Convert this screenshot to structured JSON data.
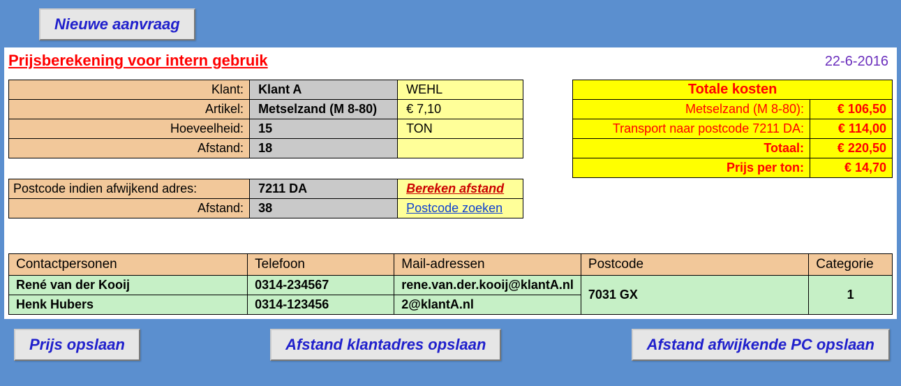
{
  "header": {
    "new_request": "Nieuwe aanvraag"
  },
  "title": "Prijsberekening voor intern gebruik",
  "date": "22-6-2016",
  "inputs": {
    "klant_label": "Klant:",
    "klant": "Klant A",
    "klant_plaats": "WEHL",
    "artikel_label": "Artikel:",
    "artikel": "Metselzand (M 8-80)",
    "artikel_prijs": "€ 7,10",
    "hoeveelheid_label": "Hoeveelheid:",
    "hoeveelheid": "15",
    "hoeveelheid_unit": "TON",
    "afstand_label": "Afstand:",
    "afstand": "18",
    "postcode_afw_label": "Postcode indien afwijkend adres:",
    "postcode_afw": "7211 DA",
    "bereken_afstand": "Bereken afstand",
    "afstand2_label": "Afstand:",
    "afstand2": "38",
    "postcode_zoeken": "Postcode zoeken"
  },
  "costs": {
    "head": "Totale kosten",
    "l1_label": "Metselzand (M 8-80):",
    "l1_val": "€ 106,50",
    "l2_label": "Transport naar postcode 7211 DA:",
    "l2_val": "€ 114,00",
    "l3_label": "Totaal:",
    "l3_val": "€ 220,50",
    "l4_label": "Prijs per ton:",
    "l4_val": "€ 14,70"
  },
  "contacts": {
    "h_name": "Contactpersonen",
    "h_tel": "Telefoon",
    "h_mail": "Mail-adressen",
    "h_pc": "Postcode",
    "h_cat": "Categorie",
    "r1_name": "René van der Kooij",
    "r1_tel": "0314-234567",
    "r1_mail": "rene.van.der.kooij@klantA.nl",
    "r2_name": "Henk Hubers",
    "r2_tel": "0314-123456",
    "r2_mail": "2@klantA.nl",
    "pc": "7031 GX",
    "cat": "1"
  },
  "buttons": {
    "save_price": "Prijs opslaan",
    "save_dist": "Afstand klantadres opslaan",
    "save_dist_alt": "Afstand afwijkende PC opslaan"
  }
}
